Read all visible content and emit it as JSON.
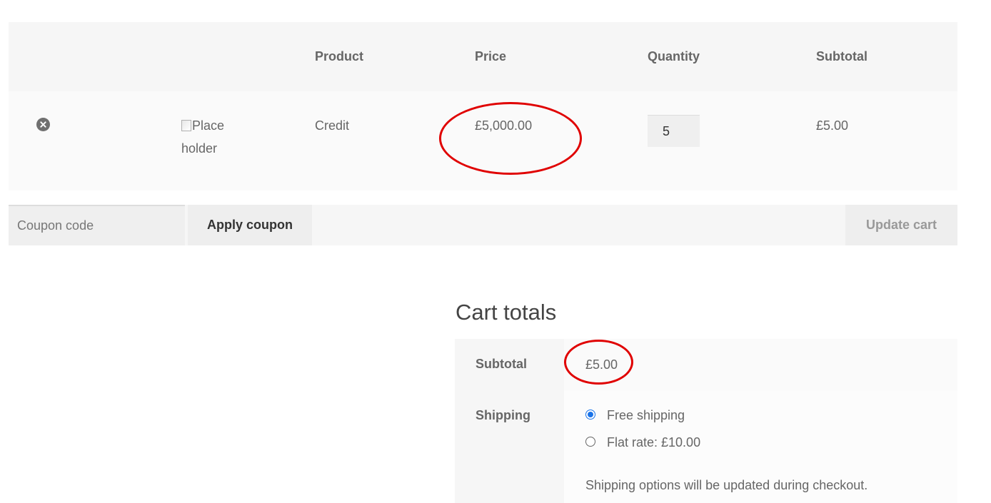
{
  "cart": {
    "headers": {
      "product": "Product",
      "price": "Price",
      "quantity": "Quantity",
      "subtotal": "Subtotal"
    },
    "items": [
      {
        "thumbnail_alt_line1": "Place",
        "thumbnail_alt_line2": "holder",
        "product": "Credit",
        "price": "£5,000.00",
        "quantity": "5",
        "subtotal": "£5.00"
      }
    ],
    "coupon_placeholder": "Coupon code",
    "apply_coupon_label": "Apply coupon",
    "update_cart_label": "Update cart"
  },
  "totals": {
    "title": "Cart totals",
    "subtotal_label": "Subtotal",
    "subtotal_value": "£5.00",
    "shipping_label": "Shipping",
    "shipping_options": [
      {
        "label": "Free shipping",
        "selected": true
      },
      {
        "label": "Flat rate: £10.00",
        "selected": false
      }
    ],
    "shipping_note": "Shipping options will be updated during checkout."
  },
  "icons": {
    "remove": "close-circle-icon",
    "thumbnail": "broken-image-icon"
  },
  "colors": {
    "annotation": "#e00000",
    "radio_accent": "#1a73e8"
  }
}
